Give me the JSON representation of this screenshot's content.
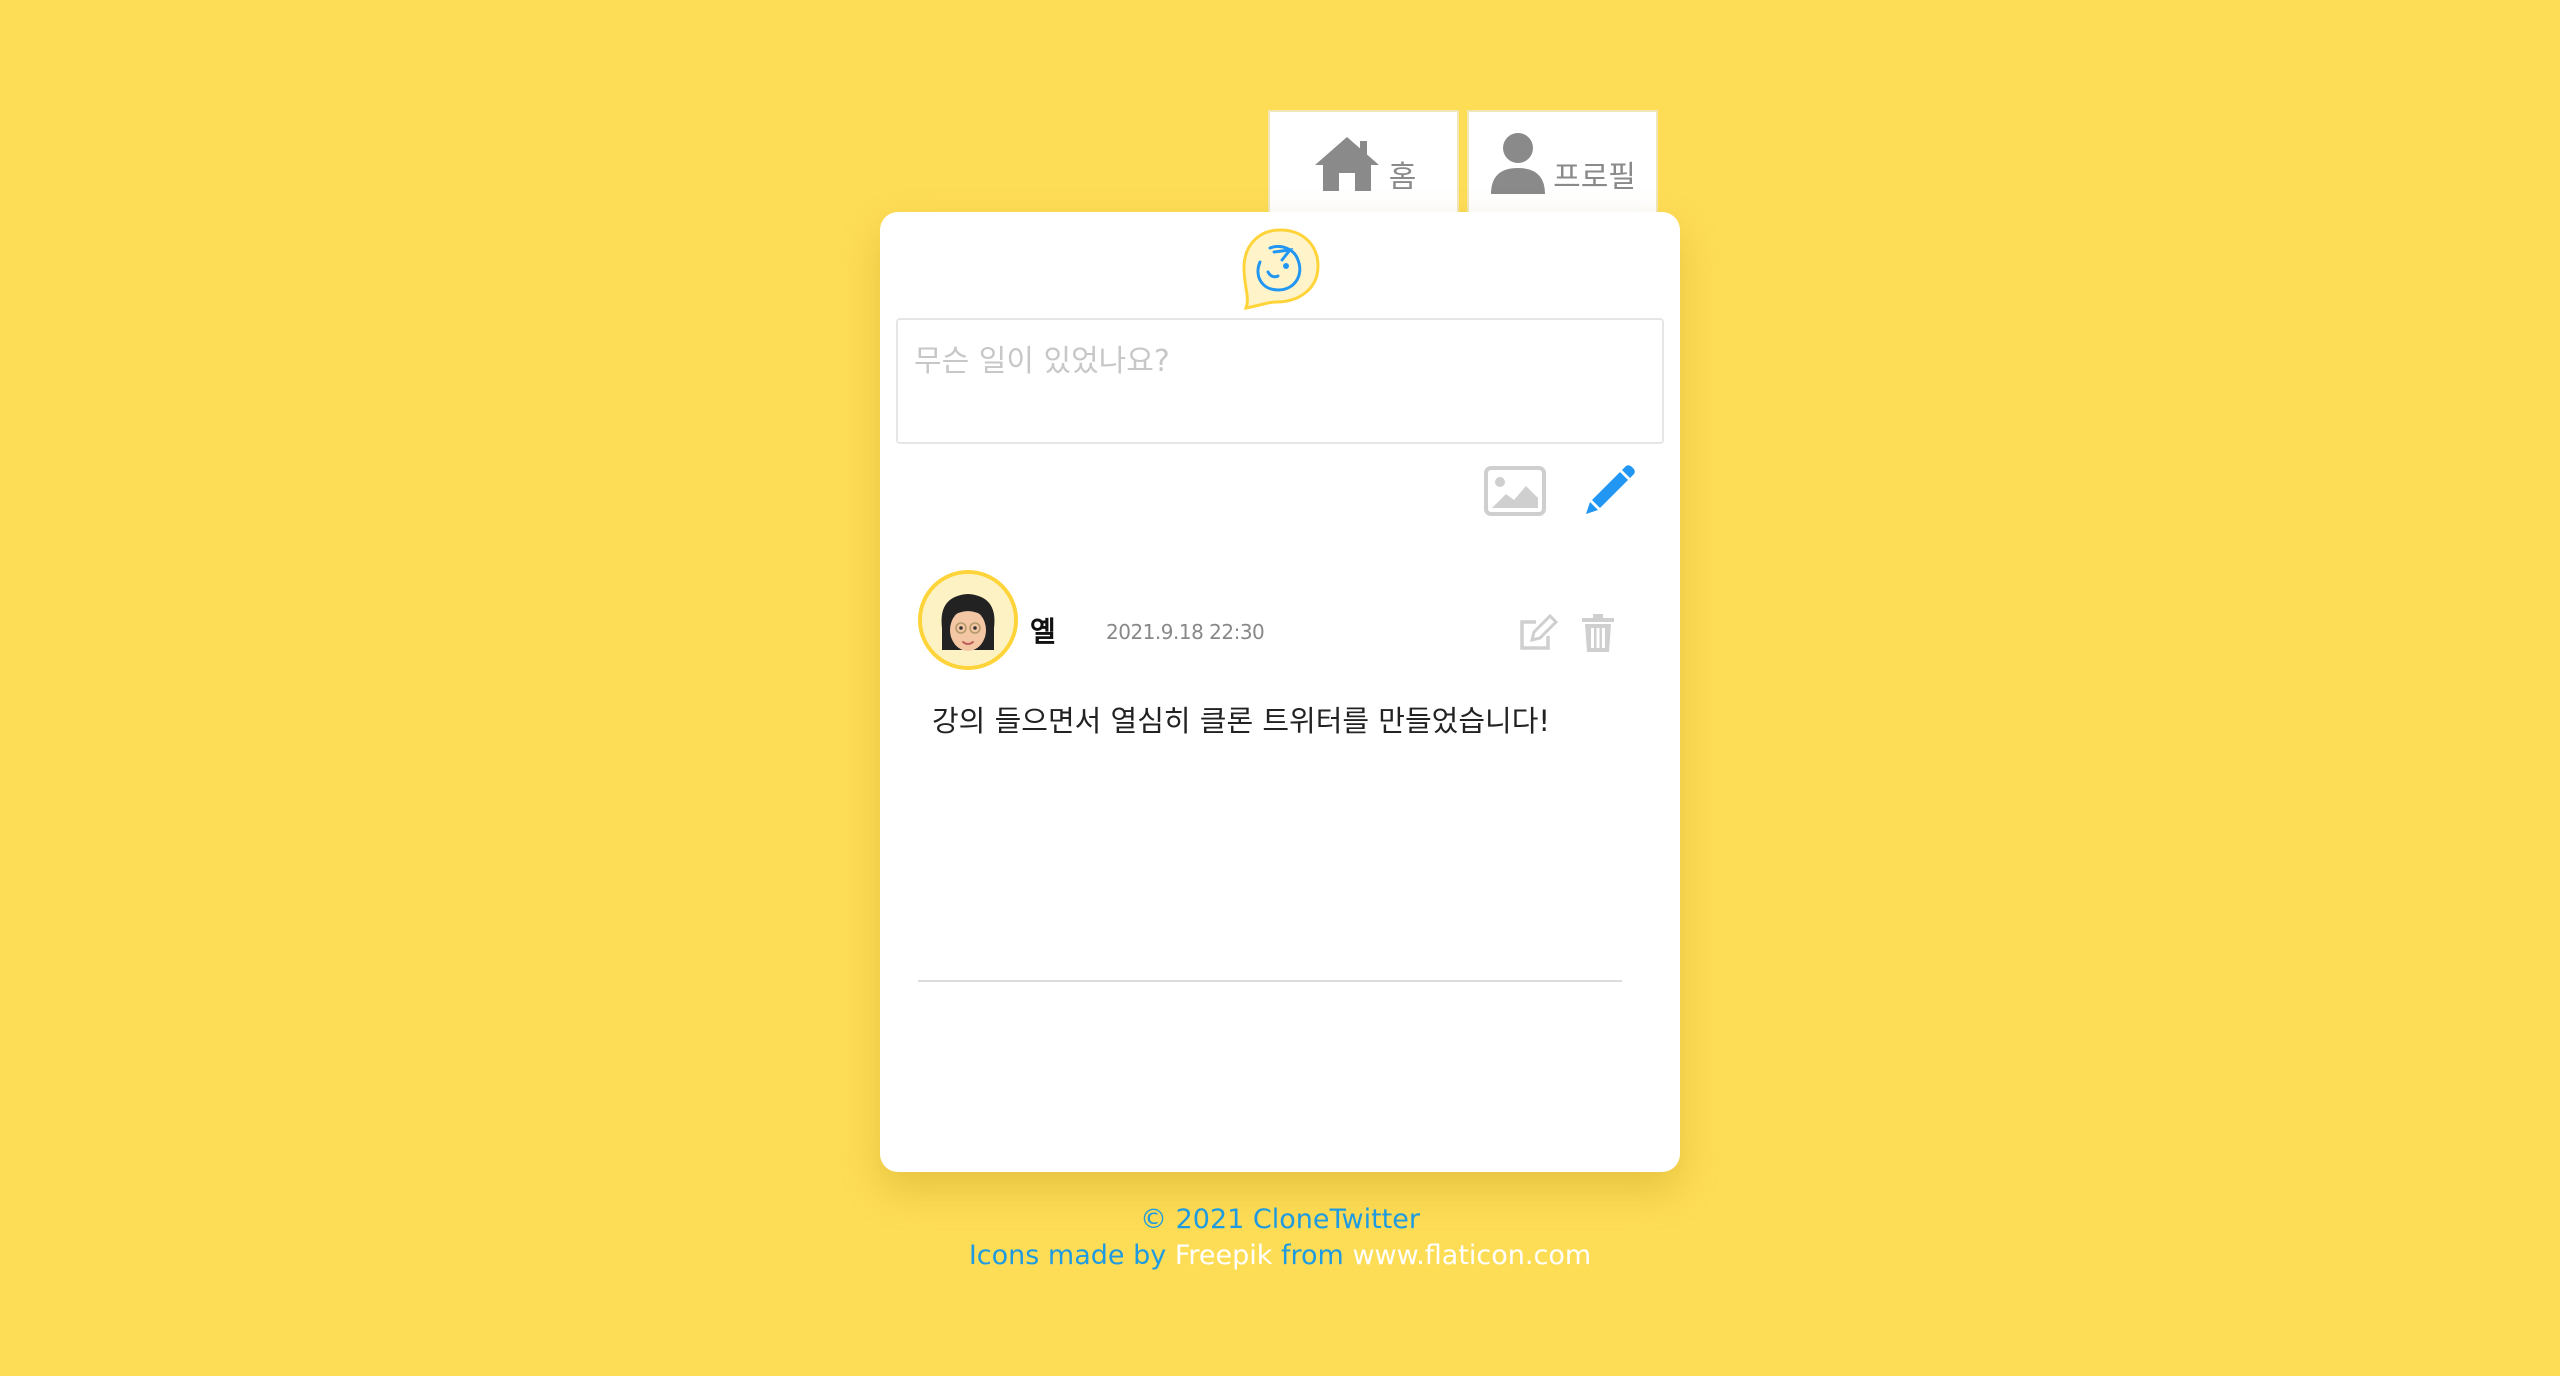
{
  "nav": {
    "home_label": "홈",
    "profile_label": "프로필"
  },
  "composer": {
    "placeholder": "무슨 일이 있었나요?"
  },
  "tweet": {
    "author": "옐",
    "timestamp": "2021.9.18 22:30",
    "text": "강의 들으면서 열심히 클론 트위터를 만들었습니다!"
  },
  "footer": {
    "copyright": "© 2021 CloneTwitter",
    "credit_prefix": "Icons made by",
    "credit_author": "Freepik",
    "credit_from": "from",
    "credit_site": "www.flaticon.com"
  },
  "colors": {
    "background": "#FEDD56",
    "accent_blue": "#1E9BE0",
    "icon_gray": "#8a8a8a"
  },
  "icons": [
    "home-icon",
    "user-icon",
    "logo-icon",
    "image-icon",
    "pencil-icon",
    "edit-icon",
    "trash-icon"
  ]
}
